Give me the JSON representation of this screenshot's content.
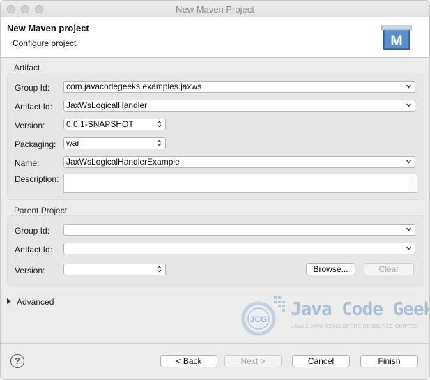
{
  "window": {
    "title": "New Maven Project"
  },
  "header": {
    "title": "New Maven project",
    "subtitle": "Configure project"
  },
  "artifact": {
    "section_label": "Artifact",
    "group_id": {
      "label": "Group Id:",
      "value": "com.javacodegeeks.examples.jaxws"
    },
    "artifact_id": {
      "label": "Artifact Id:",
      "value": "JaxWsLogicalHandler"
    },
    "version": {
      "label": "Version:",
      "value": "0.0.1-SNAPSHOT"
    },
    "packaging": {
      "label": "Packaging:",
      "value": "war"
    },
    "name": {
      "label": "Name:",
      "value": "JaxWsLogicalHandlerExample"
    },
    "description": {
      "label": "Description:",
      "value": ""
    }
  },
  "parent": {
    "section_label": "Parent Project",
    "group_id": {
      "label": "Group Id:",
      "value": ""
    },
    "artifact_id": {
      "label": "Artifact Id:",
      "value": ""
    },
    "version": {
      "label": "Version:",
      "value": ""
    },
    "browse_label": "Browse...",
    "clear_label": "Clear"
  },
  "advanced": {
    "label": "Advanced"
  },
  "watermark": {
    "title": "Java Code Geeks",
    "tagline": "JAVA 2 JAVA DEVELOPERS RESOURCE CENTER"
  },
  "footer": {
    "back_label": "< Back",
    "next_label": "Next >",
    "cancel_label": "Cancel",
    "finish_label": "Finish"
  },
  "colors": {
    "window_bg": "#ececec",
    "header_bg": "#ffffff",
    "group_bg": "#e6e6e6",
    "watermark": "#a8bfd6"
  }
}
